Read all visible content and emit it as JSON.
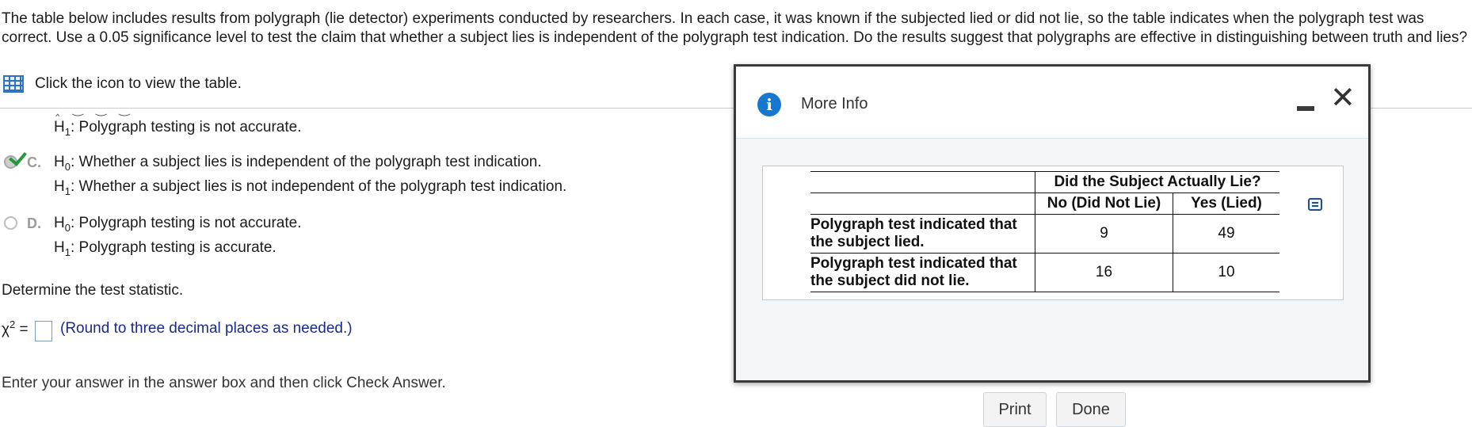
{
  "intro": {
    "text": "The table below includes results from polygraph (lie detector) experiments conducted by researchers. In each case, it was known if the subjected lied or did not lie, so the table indicates when the polygraph test was correct. Use a 0.05 significance level to test the claim that whether a subject lies is independent of the polygraph test indication. Do the results suggest that polygraphs are effective in distinguishing between truth and lies?"
  },
  "table_link": {
    "label": "Click the icon to view the table."
  },
  "options": {
    "b_h1": "Polygraph testing is not accurate.",
    "c": {
      "letter": "C.",
      "h0": "Whether a subject lies is independent of the polygraph test indication.",
      "h1": "Whether a subject lies is not independent of the polygraph test indication.",
      "selected": true
    },
    "d": {
      "letter": "D.",
      "h0": "Polygraph testing is not accurate.",
      "h1": "Polygraph testing is accurate.",
      "selected": false
    }
  },
  "hyp": {
    "h": "H",
    "zero": "0",
    "one": "1",
    "colon": ":"
  },
  "statistic": {
    "prompt": "Determine the test statistic.",
    "symbol": "χ",
    "equals": "=",
    "value": "",
    "hint": "(Round to three decimal places as needed.)"
  },
  "footer": {
    "hint": "Enter your answer in the answer box and then click Check Answer."
  },
  "modal": {
    "title": "More Info",
    "table": {
      "group_header": "Did the Subject Actually Lie?",
      "columns": [
        "No (Did Not Lie)",
        "Yes (Lied)"
      ],
      "rows": [
        {
          "label_line1": "Polygraph test indicated that",
          "label_line2": "the subject lied.",
          "values": [
            "9",
            "49"
          ]
        },
        {
          "label_line1": "Polygraph test indicated that",
          "label_line2": "the subject did not lie.",
          "values": [
            "16",
            "10"
          ]
        }
      ]
    },
    "print_label": "Print",
    "done_label": "Done"
  },
  "colors": {
    "accent": "#1778d1",
    "check": "#1f9b3c",
    "hint": "#1a2a8a"
  }
}
